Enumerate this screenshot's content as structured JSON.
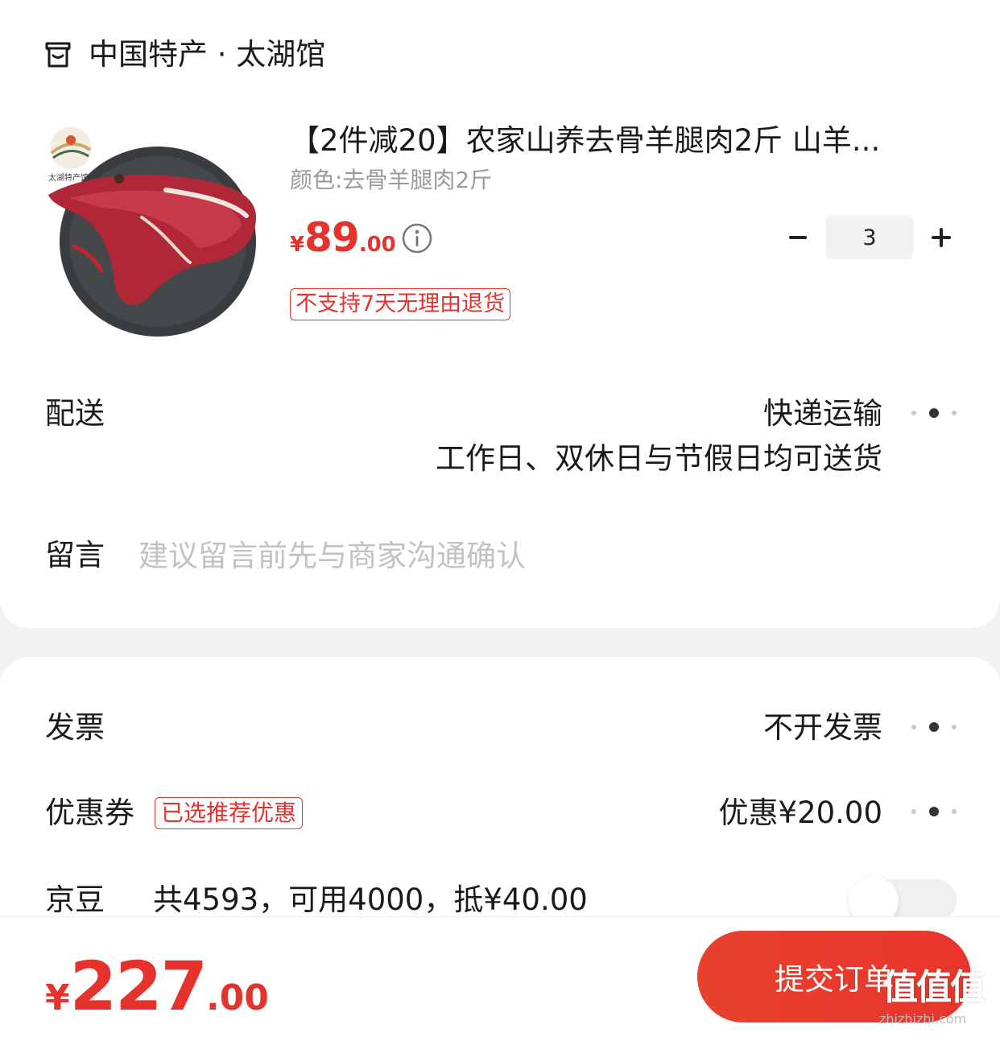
{
  "shop": {
    "icon": "shop-icon",
    "name": "中国特产 · 太湖馆"
  },
  "product": {
    "image_label": "太湖特产馆",
    "title": "【2件减20】农家山养去骨羊腿肉2斤 山羊...",
    "spec": "颜色:去骨羊腿肉2斤",
    "price_currency": "¥",
    "price_int": "89",
    "price_dec": ".00",
    "quantity": "3",
    "return_policy": "不支持7天无理由退货"
  },
  "delivery": {
    "label": "配送",
    "method": "快递运输",
    "schedule": "工作日、双休日与节假日均可送货"
  },
  "note": {
    "label": "留言",
    "placeholder": "建议留言前先与商家沟通确认"
  },
  "invoice": {
    "label": "发票",
    "value": "不开发票"
  },
  "coupon": {
    "label": "优惠券",
    "badge": "已选推荐优惠",
    "value": "优惠¥20.00"
  },
  "jd_beans": {
    "label": "京豆",
    "value": "共4593，可用4000，抵¥40.00",
    "enabled": false
  },
  "total": {
    "currency": "¥",
    "int": "227",
    "dec": ".00"
  },
  "submit_label": "提交订单",
  "watermark": {
    "logo": "值值值",
    "url": "zhizhizhi.com"
  },
  "colors": {
    "accent": "#e5322d",
    "background": "#f2f2f2"
  }
}
